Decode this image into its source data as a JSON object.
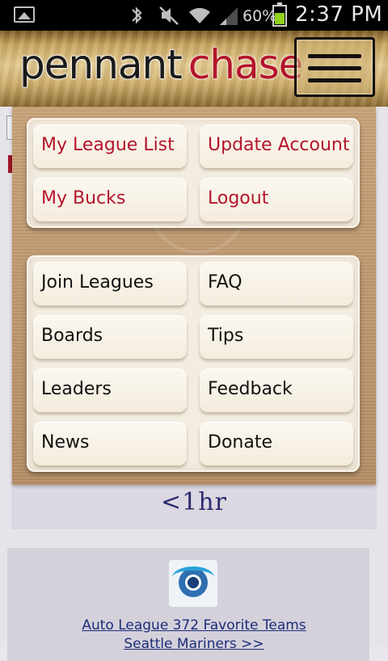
{
  "status_bar": {
    "battery_percent": "60%",
    "time": "2:37 PM",
    "icons": [
      "picture-icon",
      "bluetooth-icon",
      "mute-icon",
      "wifi-icon",
      "signal-icon",
      "battery-icon"
    ]
  },
  "header": {
    "logo_part1": "pennant",
    "logo_part2": "chase",
    "menu_icon": "hamburger-icon"
  },
  "menu": {
    "account_items": [
      {
        "label": "My League List"
      },
      {
        "label": "Update Account"
      },
      {
        "label": "My Bucks"
      },
      {
        "label": "Logout"
      }
    ],
    "site_items": [
      {
        "label": "Join Leagues"
      },
      {
        "label": "FAQ"
      },
      {
        "label": "Boards"
      },
      {
        "label": "Tips"
      },
      {
        "label": "Leaders"
      },
      {
        "label": "Feedback"
      },
      {
        "label": "News"
      },
      {
        "label": "Donate"
      }
    ]
  },
  "background_page": {
    "time_text": "<1hr",
    "league_link": "Auto League 372 Favorite Teams",
    "team_link": "Seattle Mariners   >>"
  },
  "colors": {
    "brand_red": "#b4152b",
    "menu_wood": "#b58e66",
    "button_cream": "#f4ecdd"
  }
}
